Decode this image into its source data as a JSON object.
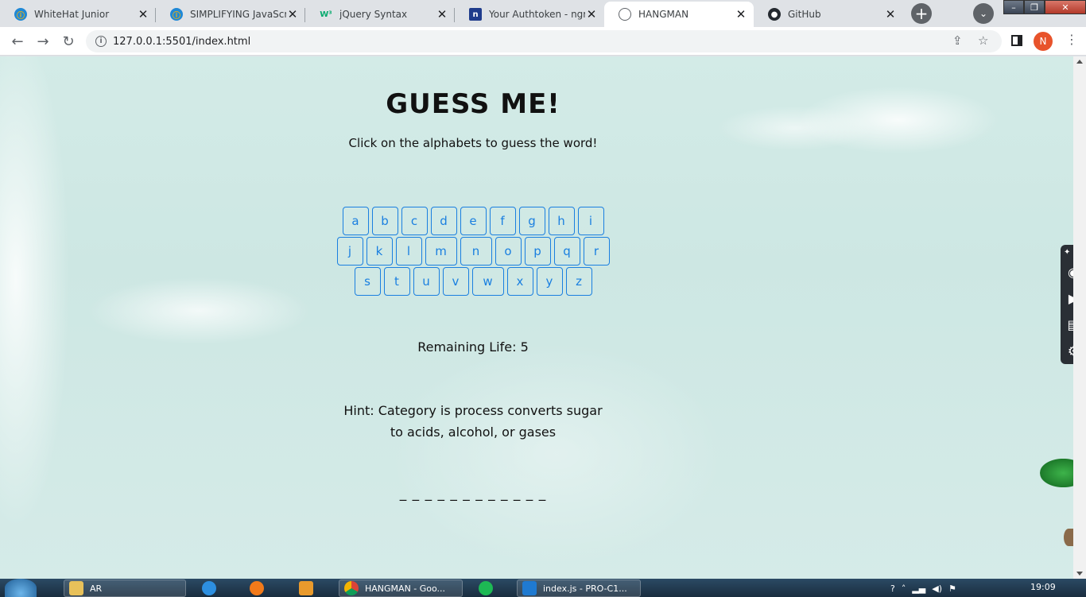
{
  "browser": {
    "tabs": [
      {
        "title": "WhiteHat Junior",
        "icon": "whitehat-icon"
      },
      {
        "title": "SIMPLIFYING JavaScript",
        "icon": "whitehat-icon"
      },
      {
        "title": "jQuery Syntax",
        "icon": "w3schools-icon"
      },
      {
        "title": "Your Authtoken - ngrok",
        "icon": "ngrok-icon"
      },
      {
        "title": "HANGMAN",
        "icon": "globe-icon",
        "active": true
      },
      {
        "title": "GitHub",
        "icon": "github-icon"
      }
    ],
    "url": "127.0.0.1:5501/index.html",
    "profile_initial": "N"
  },
  "game": {
    "title": "GUESS ME!",
    "subtitle": "Click on the alphabets to guess the word!",
    "letters_row1": [
      "a",
      "b",
      "c",
      "d",
      "e",
      "f",
      "g",
      "h",
      "i"
    ],
    "letters_row2": [
      "j",
      "k",
      "l",
      "m",
      "n",
      "o",
      "p",
      "q",
      "r"
    ],
    "letters_row3": [
      "s",
      "t",
      "u",
      "v",
      "w",
      "x",
      "y",
      "z"
    ],
    "remaining_life": "Remaining Life: 5",
    "hint": "Hint: Category is process converts sugar to acids, alcohol, or gases",
    "word_blanks": "_ _ _ _ _ _ _ _ _ _ _ _",
    "key_color": "#1a7fe0"
  },
  "taskbar": {
    "items": [
      {
        "label": "AR",
        "icon": "folder-icon"
      },
      {
        "label": "",
        "icon": "internet-explorer-icon"
      },
      {
        "label": "",
        "icon": "firefox-icon"
      },
      {
        "label": "",
        "icon": "media-player-icon"
      },
      {
        "label": "HANGMAN - Goo...",
        "icon": "chrome-icon"
      },
      {
        "label": "",
        "icon": "spotify-icon"
      },
      {
        "label": "index.js - PRO-C1...",
        "icon": "vscode-icon"
      }
    ],
    "clock": "19:09"
  }
}
